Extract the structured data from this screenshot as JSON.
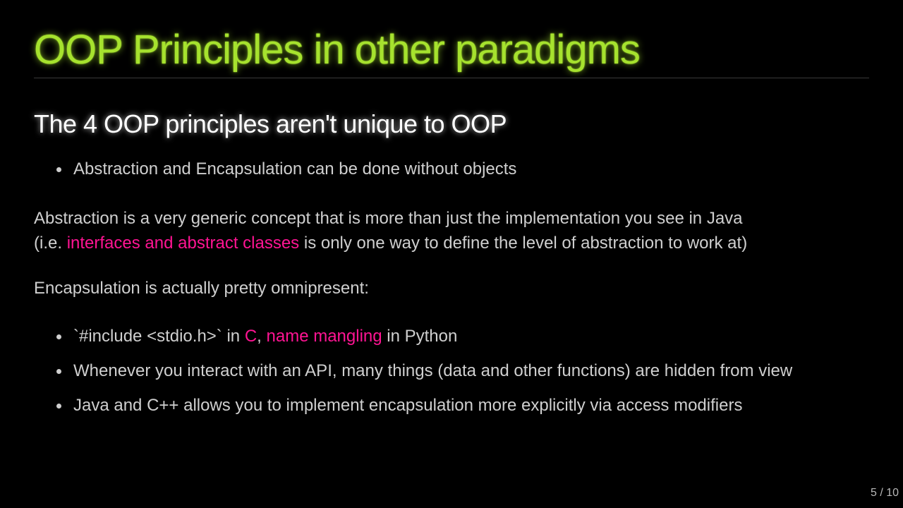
{
  "slide": {
    "title": "OOP Principles in other paradigms",
    "subtitle": "The 4 OOP principles aren't unique to OOP",
    "bullets_1": [
      {
        "text": "Abstraction and Encapsulation can be done without objects"
      }
    ],
    "paragraph_1": {
      "line_1": "Abstraction is a very generic concept that is more than just the implementation you see in Java",
      "line_2_prefix": "(i.e. ",
      "line_2_link": "interfaces and abstract classes",
      "line_2_suffix": " is only one way to define the level of abstraction to work at)"
    },
    "paragraph_2": "Encapsulation is actually pretty omnipresent:",
    "bullets_2": {
      "item_1": {
        "prefix": "`#include <stdio.h>` in ",
        "link_c": "C",
        "comma": ", ",
        "link_mangling": "name mangling",
        "suffix": " in Python"
      },
      "item_2": "Whenever you interact with an API, many things (data and other functions) are hidden from view",
      "item_3": "Java and C++ allows you to implement encapsulation more explicitly via access modifiers"
    },
    "page_number": "5 / 10"
  },
  "colors": {
    "background": "#000000",
    "title": "#a6e22e",
    "link": "#ff1493",
    "body_text": "#cfcfcf",
    "subtitle": "#ffffff"
  }
}
